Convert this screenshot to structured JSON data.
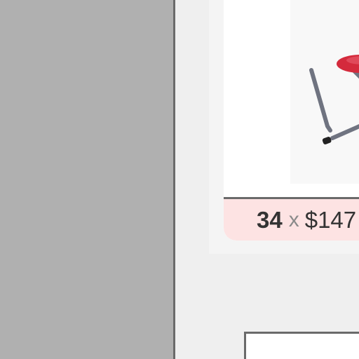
{
  "cart_item": {
    "quantity": "34",
    "times_symbol": "x",
    "unit_price": "$147"
  },
  "colors": {
    "left_panel": "#b0b0b0",
    "divider": "#6a6a6a",
    "price_bar_bg": "#fde3e3",
    "stool_seat": "#d42a3c",
    "stool_frame": "#6f7380"
  },
  "icons": {
    "product_image": "red-stool-image"
  }
}
